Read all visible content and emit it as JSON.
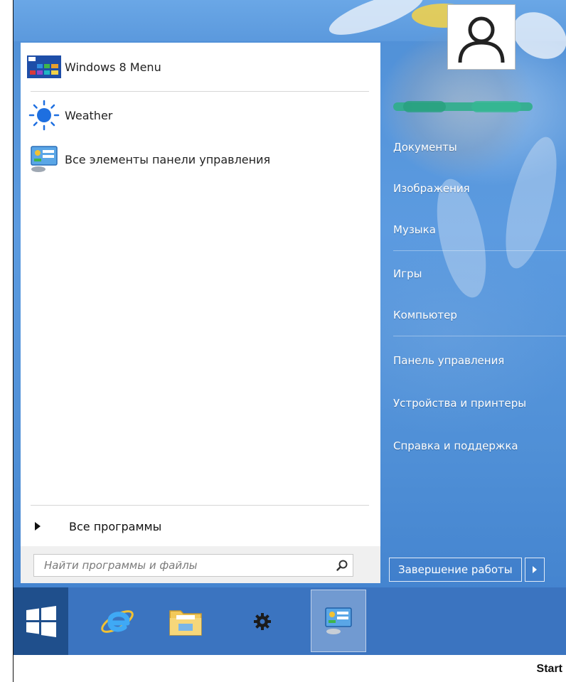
{
  "start_menu": {
    "pinned": [
      {
        "label": "Windows 8 Menu",
        "icon": "windows8-menu-icon"
      },
      {
        "label": "Weather",
        "icon": "weather-sun-icon"
      },
      {
        "label": "Все элементы панели управления",
        "icon": "control-panel-icon"
      }
    ],
    "all_programs_label": "Все программы",
    "search_placeholder": "Найти программы и файлы"
  },
  "right_panel": {
    "items": [
      {
        "label": "Документы"
      },
      {
        "label": "Изображения"
      },
      {
        "label": "Музыка"
      },
      {
        "label": "Игры"
      },
      {
        "label": "Компьютер"
      },
      {
        "label": "Панель управления"
      },
      {
        "label": "Устройства и принтеры"
      },
      {
        "label": "Справка и поддержка"
      }
    ],
    "shutdown_label": "Завершение работы"
  },
  "taskbar": {
    "items": [
      {
        "icon": "windows-logo-icon"
      },
      {
        "icon": "internet-explorer-icon"
      },
      {
        "icon": "file-explorer-icon"
      },
      {
        "icon": "settings-gear-icon"
      },
      {
        "icon": "control-panel-icon"
      }
    ]
  },
  "caption": "Start",
  "colors": {
    "accent": "#3b74c0",
    "username_blurred": "#2fae8a"
  }
}
